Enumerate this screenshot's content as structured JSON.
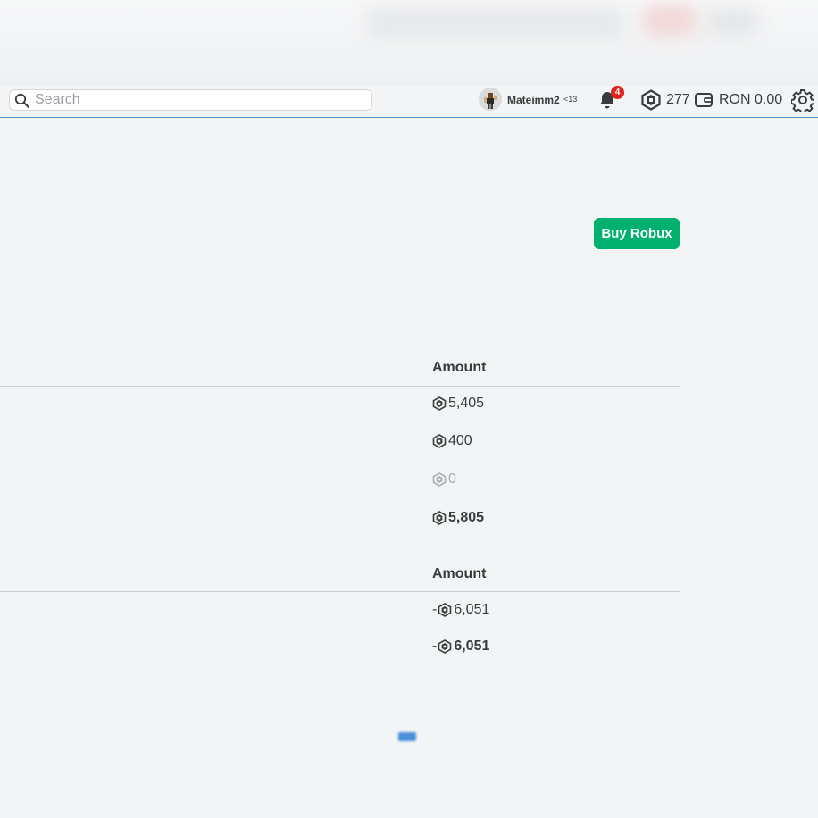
{
  "topbar": {
    "search_placeholder": "Search",
    "username": "Mateimm2",
    "age_tag": "<13",
    "notification_count": "4",
    "robux_balance": "277",
    "wallet_balance": "RON 0.00"
  },
  "buy_robux_label": "Buy Robux",
  "summary_table": {
    "header": "Amount",
    "rows": [
      {
        "amount": "5,405"
      },
      {
        "amount": "400"
      },
      {
        "amount": "0"
      },
      {
        "amount": "5,805"
      }
    ]
  },
  "spent_table": {
    "header": "Amount",
    "rows": [
      {
        "sign": "-",
        "amount": "6,051"
      },
      {
        "sign": "-",
        "amount": "6,051"
      }
    ]
  },
  "colors": {
    "buy_button": "#00b06f",
    "notification_badge": "#e2231a",
    "nav_underline": "#4c8ec9"
  },
  "icons": [
    "search-icon",
    "bell-icon",
    "robux-icon",
    "wallet-icon",
    "gear-icon"
  ]
}
